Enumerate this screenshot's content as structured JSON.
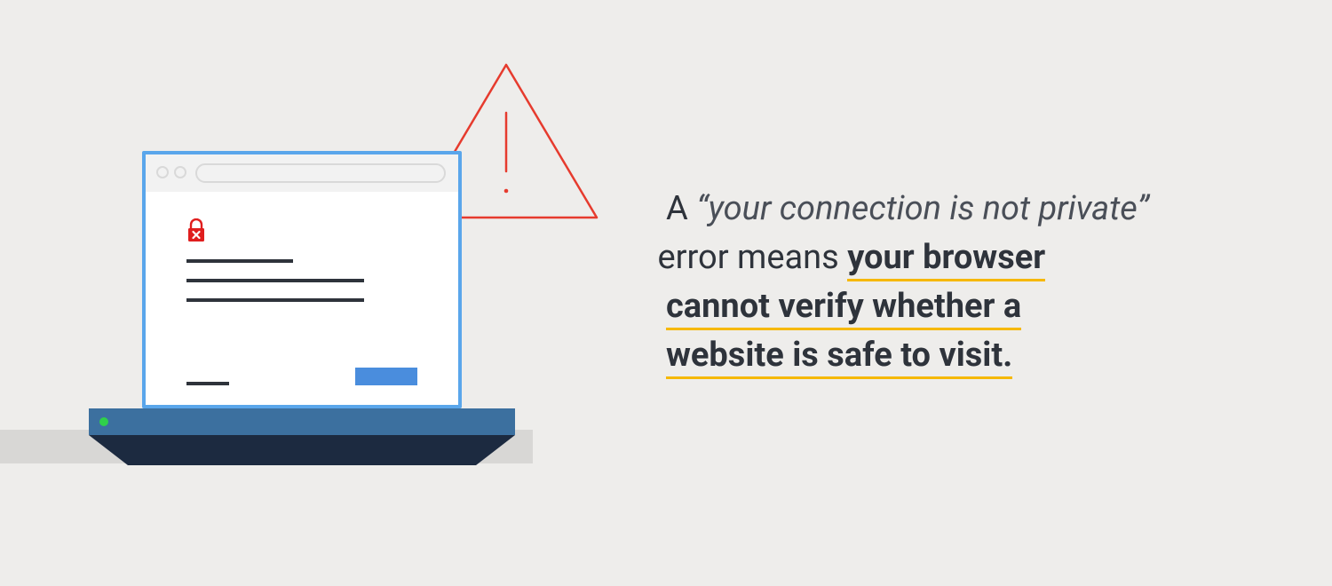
{
  "text": {
    "prefix": "A ",
    "quote_open": "“",
    "quote_phrase": "your connection is not private",
    "quote_close": "”",
    "mid": " error means ",
    "bold_line1": "your browser",
    "bold_line2": "cannot verify whether a",
    "bold_line3": "website is safe to visit."
  },
  "colors": {
    "background": "#eeedeb",
    "text": "#2e333b",
    "underline": "#f6b800",
    "laptop_bezel": "#5aa6eb",
    "laptop_base": "#3c709f",
    "laptop_front": "#1c2a40",
    "button": "#4a8ddd",
    "warning": "#e63b2e",
    "power_led": "#2fd04a"
  },
  "icons": {
    "warning": "warning-triangle",
    "lock": "lock-x"
  }
}
